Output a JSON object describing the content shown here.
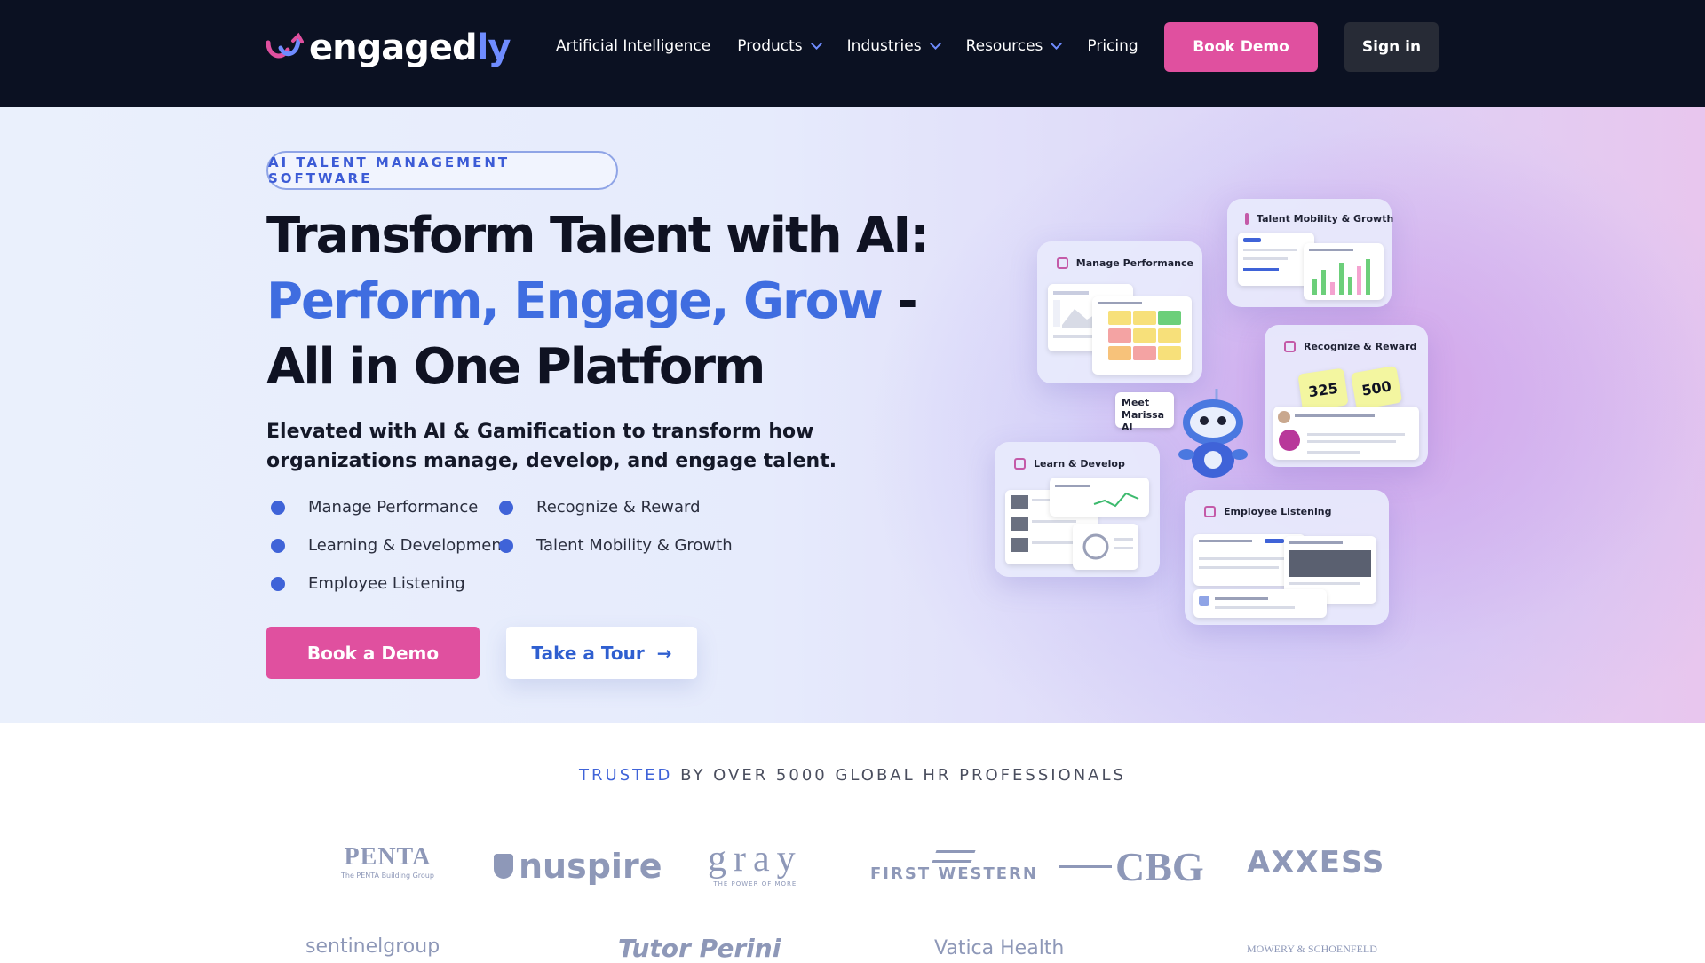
{
  "nav": {
    "brand_main": "engaged",
    "brand_accent": "ly",
    "links": [
      {
        "label": "Artificial Intelligence",
        "dropdown": false
      },
      {
        "label": "Products",
        "dropdown": true
      },
      {
        "label": "Industries",
        "dropdown": true
      },
      {
        "label": "Resources",
        "dropdown": true
      },
      {
        "label": "Pricing",
        "dropdown": false
      }
    ],
    "book_demo": "Book Demo",
    "sign_in": "Sign in"
  },
  "hero": {
    "badge": "AI TALENT MANAGEMENT SOFTWARE",
    "headline_1": "Transform Talent with AI:",
    "headline_2_blue": "Perform, Engage, Grow",
    "headline_2_dash": " -",
    "headline_3": "All in One Platform",
    "subheadline": "Elevated with AI & Gamification to transform how organizations manage, develop, and engage talent.",
    "features": [
      "Manage Performance",
      "Recognize & Reward",
      "Learning & Development",
      "Talent Mobility & Growth",
      "Employee Listening"
    ],
    "cta_primary": "Book a Demo",
    "cta_secondary": "Take a Tour",
    "cta_secondary_icon": "arrow-right-icon"
  },
  "illustration": {
    "cards": {
      "manage": "Manage Performance",
      "talent": "Talent Mobility & Growth",
      "recognize": "Recognize & Reward",
      "learn": "Learn & Develop",
      "listening": "Employee Listening"
    },
    "bubble_line1": "Meet",
    "bubble_line2": "Marissa AI",
    "points_1": "325",
    "points_2": "500"
  },
  "trusted": {
    "highlight": "TRUSTED",
    "rest": " BY OVER 5000 GLOBAL HR PROFESSIONALS"
  },
  "logos": {
    "row1": [
      "PENTA",
      "nuspire",
      "gray",
      "FIRST WESTERN",
      "CBG",
      "AXXESS"
    ],
    "penta_sub": "The PENTA Building Group",
    "gray_sub": "THE POWER OF MORE",
    "row2": [
      "sentinelgroup",
      "Tutor Perini",
      "Vatica Health",
      "MOWERY & SCHOENFELD"
    ]
  },
  "colors": {
    "nav_bg": "#0b1122",
    "accent_pink": "#e0509f",
    "accent_blue": "#3f6de0"
  }
}
